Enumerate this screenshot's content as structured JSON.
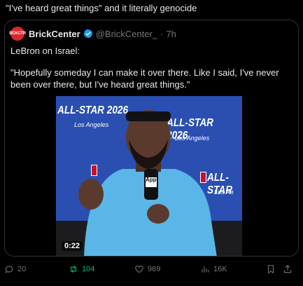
{
  "post": {
    "text": "\"I've heard great things\" and it literally genocide"
  },
  "quote": {
    "avatar_text": "BCKCTR",
    "author": "BrickCenter",
    "handle": "@BrickCenter_",
    "dot": "·",
    "time": "7h",
    "line1": "LeBron on Israel:",
    "body": "\"Hopefully someday I can make it over there. Like I said, I've never been over there, but I've heard great things.\"",
    "video": {
      "timestamp": "0:22",
      "backdrop_text": "ALL-STAR 2026",
      "backdrop_sub": "Los Angeles",
      "backdrop_text_short": "ALL-STAR",
      "backdrop_sub_short": "Los An",
      "mic_label": "App"
    }
  },
  "actions": {
    "replies": "20",
    "reposts": "104",
    "likes": "969",
    "views": "16K"
  },
  "colors": {
    "background": "#000000",
    "text": "#e7e9ea",
    "muted": "#71767b",
    "repost_active": "#00ba7c",
    "verified": "#1d9bf0",
    "brand_red": "#e0252b"
  }
}
